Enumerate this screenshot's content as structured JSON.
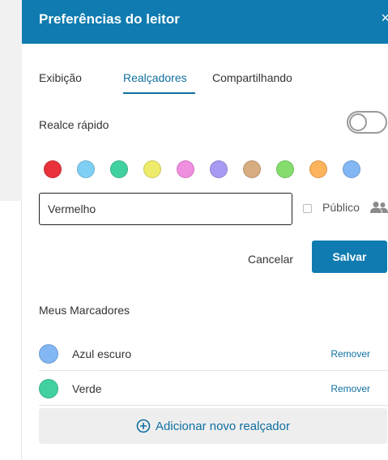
{
  "header": {
    "title": "Preferências do leitor",
    "close_glyph": "×"
  },
  "tabs": [
    {
      "label": "Exibição",
      "active": false
    },
    {
      "label": "Realçadores",
      "active": true
    },
    {
      "label": "Compartilhando",
      "active": false
    }
  ],
  "quick_highlight": {
    "label": "Realce rápido",
    "enabled": false
  },
  "swatches": [
    {
      "color": "#e8313b"
    },
    {
      "color": "#7fcff5"
    },
    {
      "color": "#41d1a0"
    },
    {
      "color": "#eeeb6a"
    },
    {
      "color": "#f08ee0"
    },
    {
      "color": "#a79af2"
    },
    {
      "color": "#d6ac80"
    },
    {
      "color": "#84dd6c"
    },
    {
      "color": "#fdb35c"
    },
    {
      "color": "#82b7f4"
    }
  ],
  "editor": {
    "name_value": "Vermelho",
    "public_label": "Público",
    "public_checked": false,
    "cancel_label": "Cancelar",
    "save_label": "Salvar"
  },
  "my_highlighters": {
    "title": "Meus Marcadores",
    "items": [
      {
        "name": "Azul escuro",
        "color": "#82b7f4",
        "remove_label": "Remover"
      },
      {
        "name": "Verde",
        "color": "#41d1a0",
        "remove_label": "Remover"
      }
    ],
    "add_label": "Adicionar novo realçador"
  },
  "colors": {
    "accent": "#0f7bb0",
    "link": "#0f6fa0"
  }
}
